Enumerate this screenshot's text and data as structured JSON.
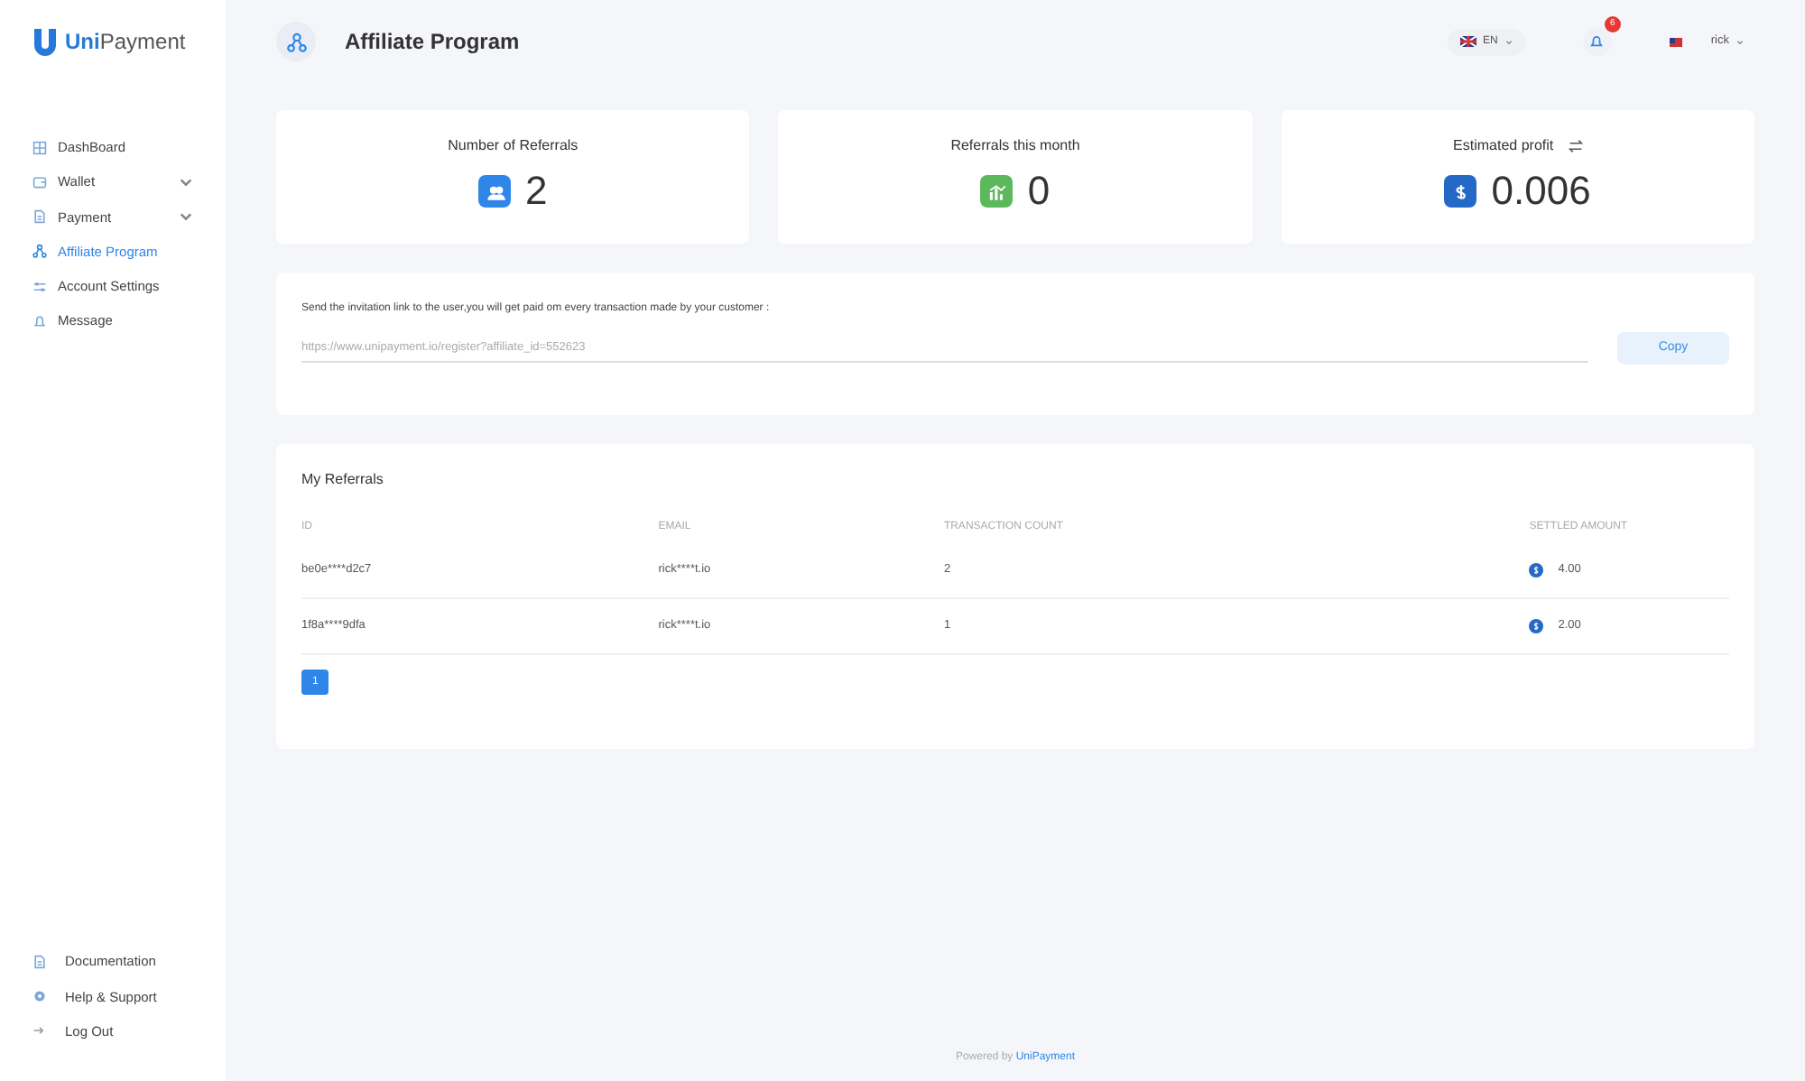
{
  "brand": {
    "first": "Uni",
    "second": "Payment"
  },
  "sidebar": {
    "items": [
      {
        "label": "DashBoard",
        "selected": false,
        "expandable": false
      },
      {
        "label": "Wallet",
        "selected": false,
        "expandable": true
      },
      {
        "label": "Payment",
        "selected": false,
        "expandable": true
      },
      {
        "label": "Affiliate Program",
        "selected": true,
        "expandable": false
      },
      {
        "label": "Account Settings",
        "selected": false,
        "expandable": false
      },
      {
        "label": "Message",
        "selected": false,
        "expandable": false
      }
    ],
    "bottom_items": [
      {
        "label": "Documentation"
      },
      {
        "label": "Help & Support"
      },
      {
        "label": "Log Out"
      }
    ]
  },
  "header": {
    "title": "Affiliate Program",
    "language": "EN",
    "notifications": "6",
    "user": "rick"
  },
  "stats": [
    {
      "label": "Number of Referrals",
      "value": "2",
      "color": "#2f86e8",
      "swap": false
    },
    {
      "label": "Referrals this month",
      "value": "0",
      "color": "#5cb85c",
      "swap": false
    },
    {
      "label": "Estimated profit",
      "value": "0.006",
      "color": "#2469c6",
      "swap": true
    }
  ],
  "invite": {
    "text": "Send the invitation link to the user,you will get paid om every transaction made by your customer :",
    "link": "https://www.unipayment.io/register?affiliate_id=552623",
    "button": "Copy"
  },
  "referrals": {
    "title": "My Referrals",
    "columns": [
      "ID",
      "EMAIL",
      "TRANSACTION COUNT",
      "SETTLED AMOUNT"
    ],
    "rows": [
      {
        "id": "be0e****d2c7",
        "email": "rick****t.io",
        "count": "2",
        "amount": "4.00"
      },
      {
        "id": "1f8a****9dfa",
        "email": "rick****t.io",
        "count": "1",
        "amount": "2.00"
      }
    ],
    "pages": [
      {
        "label": "1",
        "selected": true
      }
    ]
  },
  "footer": {
    "text": "Powered by ",
    "link": "UniPayment"
  }
}
